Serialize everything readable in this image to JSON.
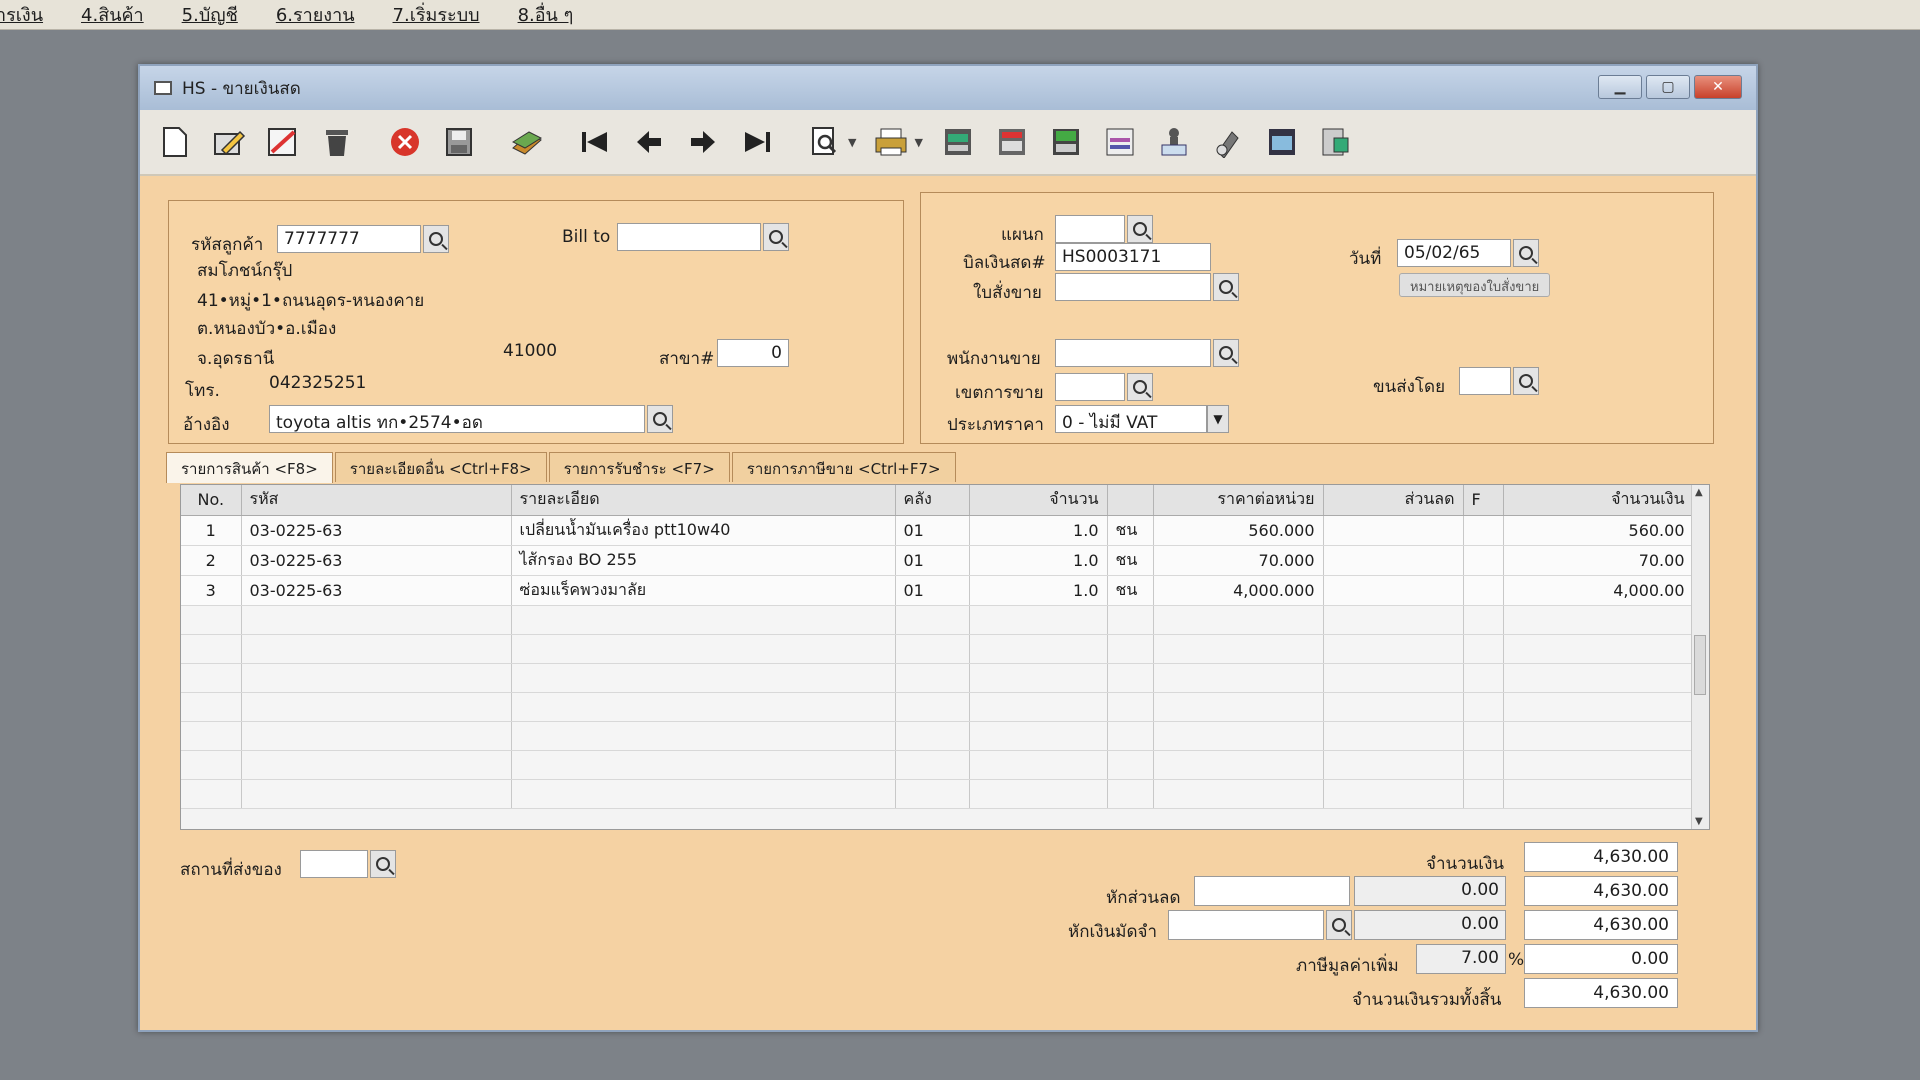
{
  "menubar": {
    "items": [
      {
        "label": "ารเงิน"
      },
      {
        "label": "4.สินค้า"
      },
      {
        "label": "5.บัญชี"
      },
      {
        "label": "6.รายงาน"
      },
      {
        "label": "7.เริ่มระบบ"
      },
      {
        "label": "8.อื่น ๆ"
      }
    ]
  },
  "window": {
    "title": "HS - ขายเงินสด",
    "controls": {
      "minimize": "▁",
      "maximize": "▢",
      "close": "✕"
    }
  },
  "toolbar": {
    "icons": [
      "new-doc-icon",
      "edit-icon",
      "void-icon",
      "delete-icon",
      "cancel-icon",
      "save-icon",
      "copy-icon",
      "first-record-icon",
      "prev-record-icon",
      "next-record-icon",
      "last-record-icon",
      "search-doc-icon",
      "print-icon",
      "calc-icon",
      "report-icon",
      "post-icon",
      "reprint-icon",
      "approve-icon",
      "check-icon",
      "ok-icon",
      "export-icon"
    ]
  },
  "customer": {
    "code_label": "รหัสลูกค้า",
    "code_value": "7777777",
    "name": "สมโภชน์กรุ๊ป",
    "address1": "41•หมู่•1•ถนนอุดร-หนองคาย",
    "address2": "ต.หนองบัว•อ.เมือง",
    "province": "จ.อุดรธานี",
    "postcode": "41000",
    "branch_label": "สาขา#",
    "branch_value": "0",
    "phone_label": "โทร.",
    "phone_value": "042325251",
    "ref_label": "อ้างอิง",
    "ref_value": "toyota altis ทก•2574•อด",
    "billto_label": "Bill to",
    "billto_value": ""
  },
  "document": {
    "dept_label": "แผนก",
    "dept_value": "",
    "bill_label": "บิลเงินสด#",
    "bill_value": "HS0003171",
    "order_label": "ใบสั่งขาย",
    "order_value": "",
    "date_label": "วันที่",
    "date_value": "05/02/65",
    "note_button": "หมายเหตุของใบสั่งขาย",
    "sales_label": "พนักงานขาย",
    "sales_value": "",
    "area_label": "เขตการขาย",
    "area_value": "",
    "ship_label": "ขนส่งโดย",
    "ship_value": "",
    "price_type_label": "ประเภทราคา",
    "price_type_value": "0 - ไม่มี VAT"
  },
  "tabs": [
    {
      "label": "รายการสินค้า <F8>"
    },
    {
      "label": "รายละเอียดอื่น <Ctrl+F8>"
    },
    {
      "label": "รายการรับชำระ <F7>"
    },
    {
      "label": "รายการภาษีขาย <Ctrl+F7>"
    }
  ],
  "grid": {
    "headers": {
      "no": "No.",
      "code": "รหัส",
      "desc": "รายละเอียด",
      "wh": "คลัง",
      "qty": "จำนวน",
      "unit": "",
      "price": "ราคาต่อหน่วย",
      "disc": "ส่วนลด",
      "f": "F",
      "amount": "จำนวนเงิน"
    },
    "rows": [
      {
        "no": "1",
        "code": "03-0225-63",
        "desc": "เปลี่ยนน้ำมันเครื่อง ptt10w40",
        "wh": "01",
        "qty": "1.0",
        "unit": "ชน",
        "price": "560.000",
        "disc": "",
        "f": "",
        "amount": "560.00"
      },
      {
        "no": "2",
        "code": "03-0225-63",
        "desc": "ไส้กรอง BO 255",
        "wh": "01",
        "qty": "1.0",
        "unit": "ชน",
        "price": "70.000",
        "disc": "",
        "f": "",
        "amount": "70.00"
      },
      {
        "no": "3",
        "code": "03-0225-63",
        "desc": "ซ่อมแร็คพวงมาลัย",
        "wh": "01",
        "qty": "1.0",
        "unit": "ชน",
        "price": "4,000.000",
        "disc": "",
        "f": "",
        "amount": "4,000.00"
      }
    ]
  },
  "footer": {
    "ship_place_label": "สถานที่ส่งของ",
    "ship_place_value": "",
    "amount_label": "จำนวนเงิน",
    "amount_value": "4,630.00",
    "discount_label": "หักส่วนลด",
    "discount_input": "",
    "discount_amount": "0.00",
    "discount_total": "4,630.00",
    "deposit_label": "หักเงินมัดจำ",
    "deposit_input": "",
    "deposit_amount": "0.00",
    "deposit_total": "4,630.00",
    "vat_label": "ภาษีมูลค่าเพิ่ม",
    "vat_rate": "7.00",
    "vat_pct_sign": "%",
    "vat_amount": "0.00",
    "grand_total_label": "จำนวนเงินรวมทั้งสิ้น",
    "grand_total_value": "4,630.00"
  }
}
